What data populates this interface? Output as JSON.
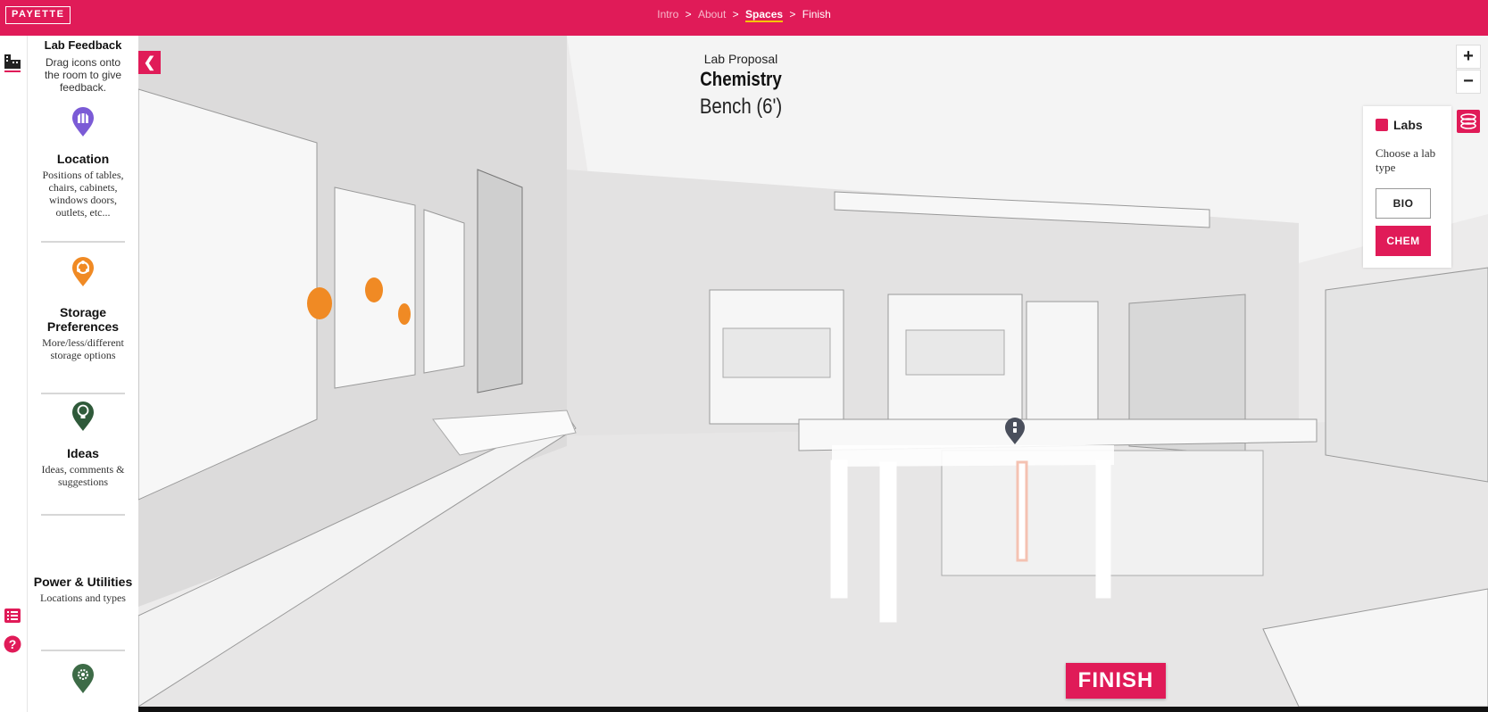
{
  "brand": {
    "logo": "PAYETTE",
    "accent": "#e01b58"
  },
  "breadcrumb": [
    {
      "label": "Intro",
      "state": "done"
    },
    {
      "label": "About",
      "state": "done"
    },
    {
      "label": "Spaces",
      "state": "active"
    },
    {
      "label": "Finish",
      "state": "upcoming"
    }
  ],
  "breadcrumb_sep": ">",
  "rail": {
    "icons": [
      "building-icon",
      "list-icon",
      "help-icon"
    ]
  },
  "feedback": {
    "title": "Lab Feedback",
    "instructions": "Drag icons onto the room to give feedback.",
    "categories": [
      {
        "title": "Location",
        "description": "Positions of tables, chairs, cabinets, windows doors, outlets, etc...",
        "icon": "location-pin-icon",
        "color": "#7b5bd6"
      },
      {
        "title": "Storage Preferences",
        "description": "More/less/different storage options",
        "icon": "storage-pin-icon",
        "color": "#f08a24"
      },
      {
        "title": "Ideas",
        "description": "Ideas, comments & suggestions",
        "icon": "ideas-pin-icon",
        "color": "#2f5a3a"
      },
      {
        "title": "Power & Utilities",
        "description": "Locations and types",
        "icon": "power-pin-icon",
        "color": "#3d6b47"
      }
    ]
  },
  "scene": {
    "proposal_label": "Lab Proposal",
    "lab_name": "Chemistry",
    "item": "Bench (6')"
  },
  "zoom": {
    "in": "+",
    "out": "−"
  },
  "labs_panel": {
    "title": "Labs",
    "description": "Choose a lab type",
    "options": [
      {
        "label": "BIO",
        "selected": false
      },
      {
        "label": "CHEM",
        "selected": true
      }
    ]
  },
  "finish_label": "FINISH"
}
